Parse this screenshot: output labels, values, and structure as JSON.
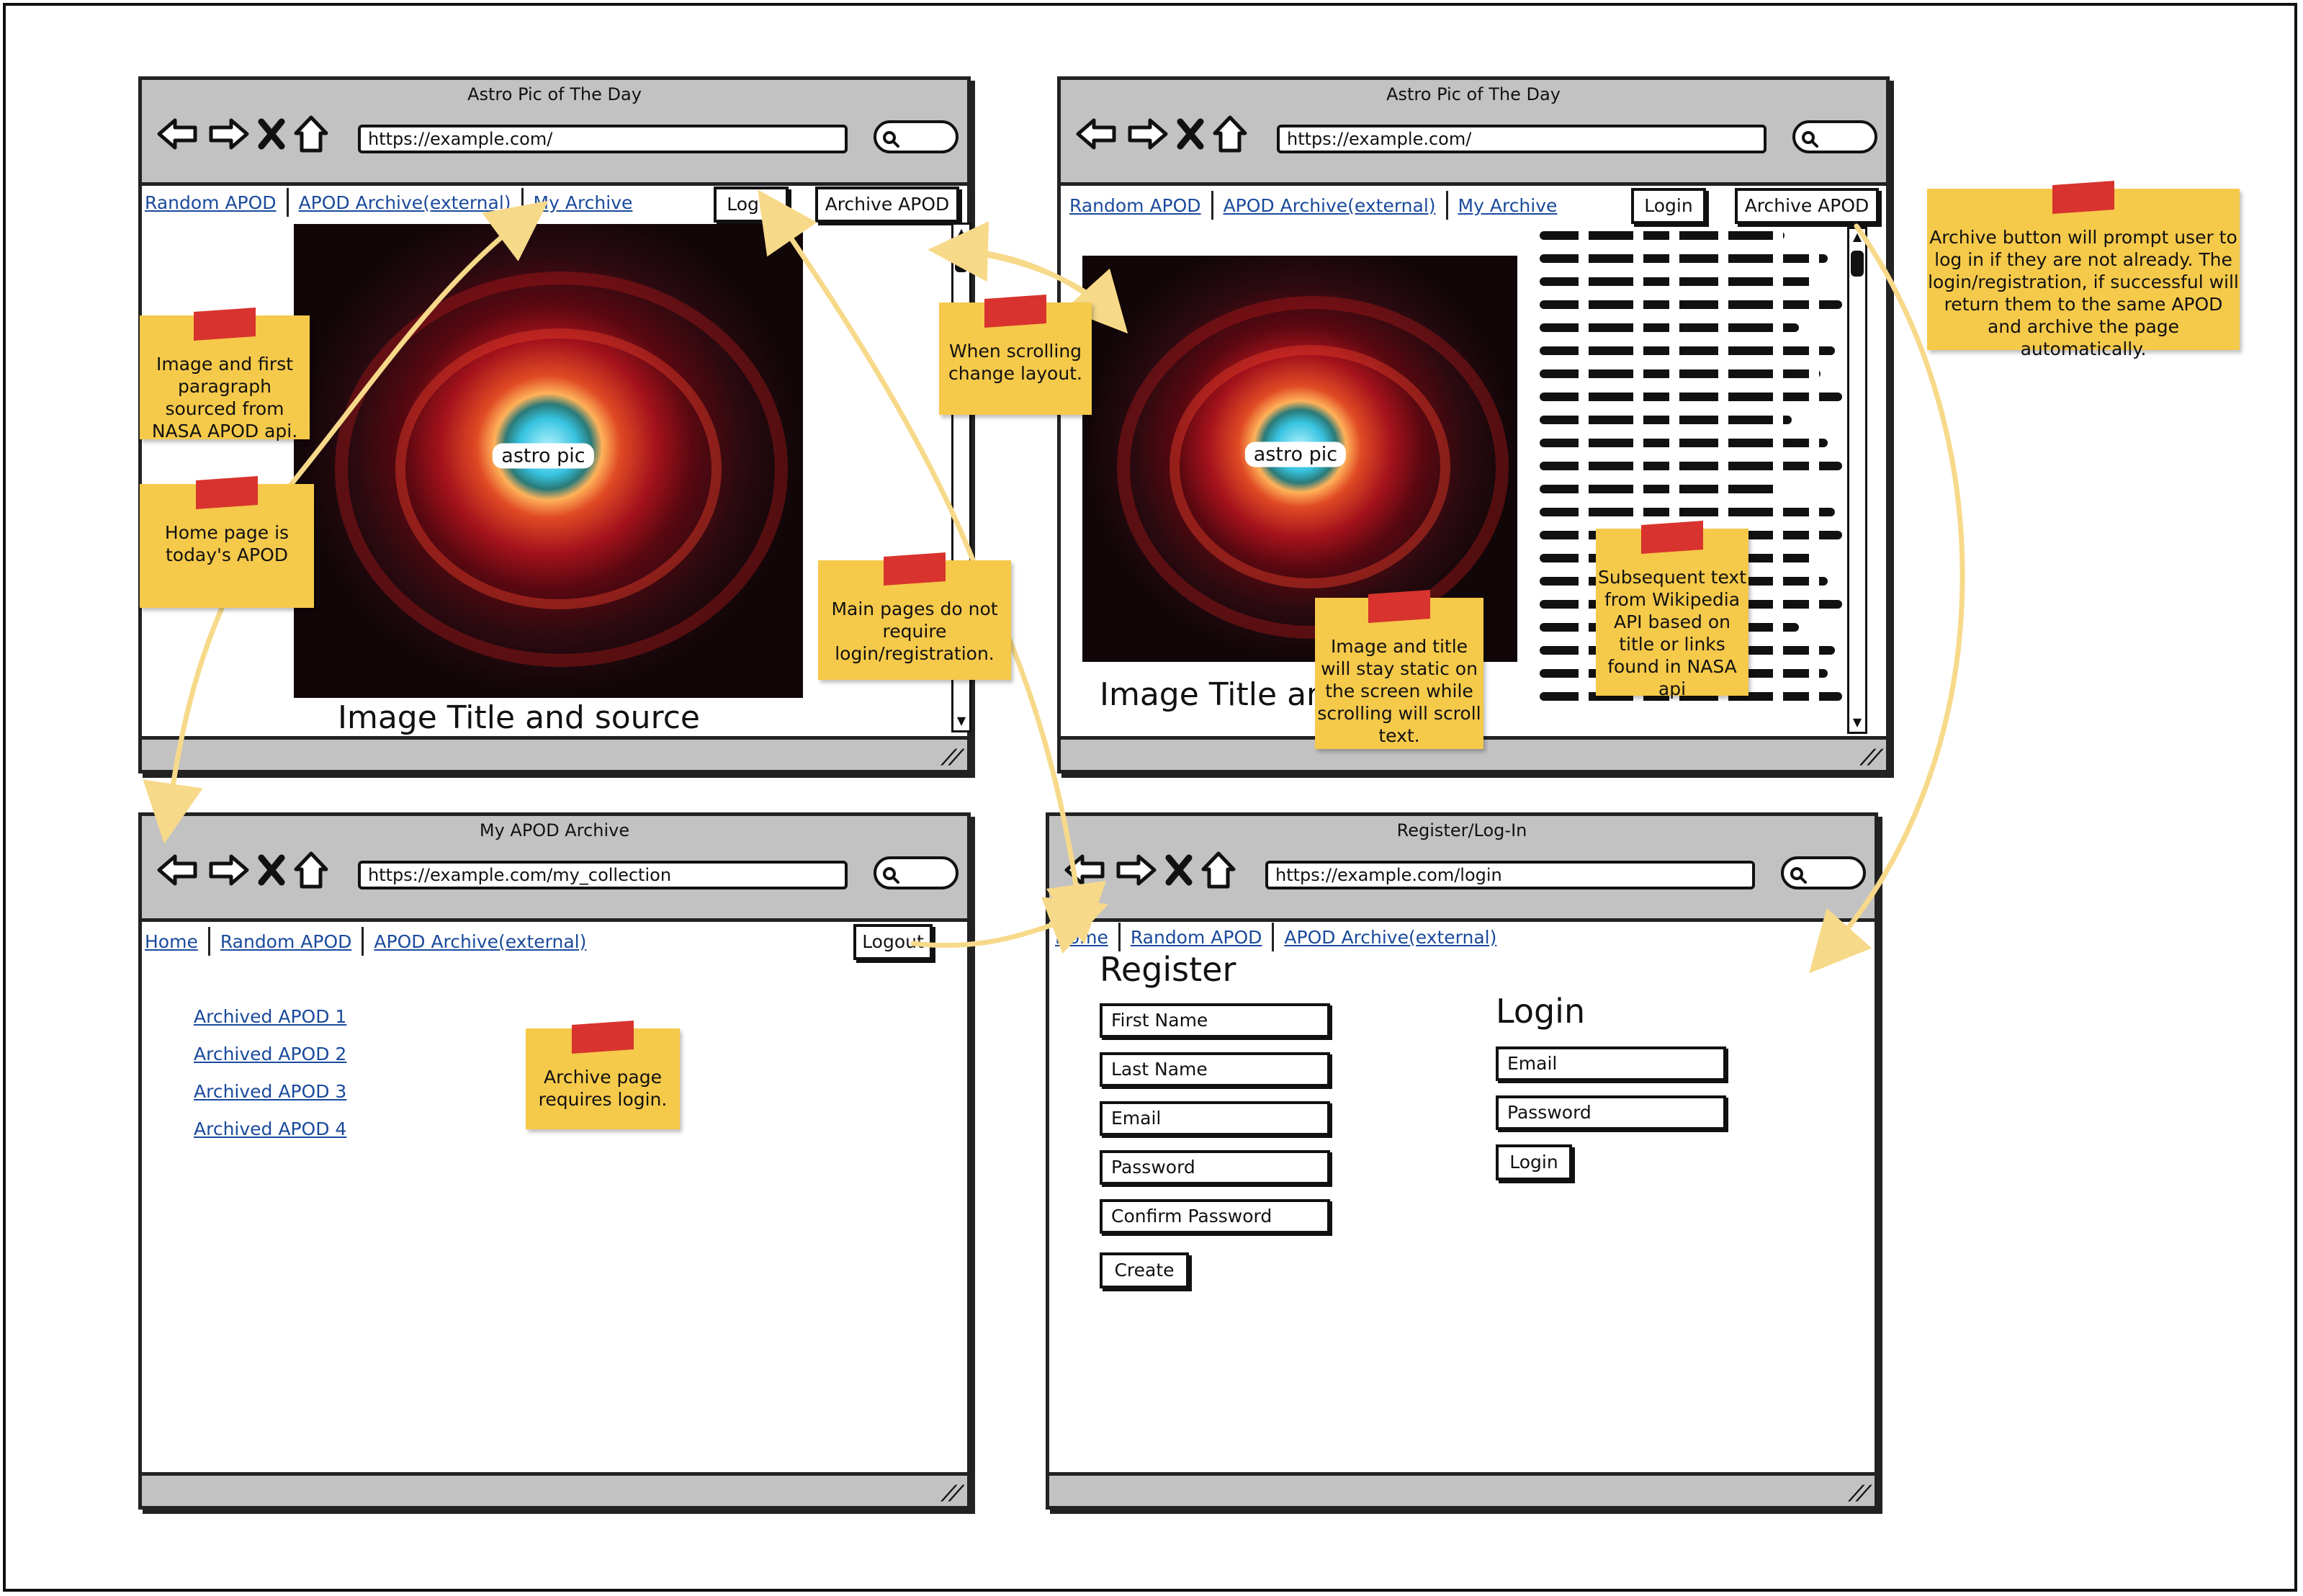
{
  "window_top_left": {
    "title": "Astro Pic of The Day",
    "url": "https://example.com/",
    "nav_links": [
      "Random APOD",
      "APOD Archive(external)",
      "My Archive"
    ],
    "login_button": "Login",
    "archive_button": "Archive APOD",
    "picture_label": "astro pic",
    "image_title": "Image Title and source"
  },
  "window_top_right": {
    "title": "Astro Pic of The Day",
    "url": "https://example.com/",
    "nav_links": [
      "Random APOD",
      "APOD Archive(external)",
      "My Archive"
    ],
    "login_button": "Login",
    "archive_button": "Archive APOD",
    "picture_label": "astro pic",
    "image_title": "Image Title an"
  },
  "window_bottom_left": {
    "title": "My APOD Archive",
    "url": "https://example.com/my_collection",
    "nav_links": [
      "Home",
      "Random APOD",
      "APOD Archive(external)"
    ],
    "logout_button": "Logout",
    "archived_items": [
      "Archived APOD 1",
      "Archived APOD 2",
      "Archived APOD 3",
      "Archived APOD 4"
    ]
  },
  "window_bottom_right": {
    "title": "Register/Log-In",
    "url": "https://example.com/login",
    "nav_links": [
      "Home",
      "Random APOD",
      "APOD Archive(external)"
    ],
    "register_heading": "Register",
    "register_fields": [
      "First Name",
      "Last Name",
      "Email",
      "Password",
      "Confirm Password"
    ],
    "create_button": "Create",
    "login_heading": "Login",
    "login_fields": [
      "Email",
      "Password"
    ],
    "login_button": "Login"
  },
  "notes": {
    "image_source": "Image and first paragraph sourced from NASA APOD api.",
    "home_page": "Home page is today's APOD",
    "scrolling": "When scrolling change layout.",
    "main_pages": "Main pages do not require login/registration.",
    "static_image": "Image and title will stay static on the screen while scrolling will scroll text.",
    "wikipedia": "Subsequent text from Wikipedia API based on title or links found in NASA api",
    "archive_button": "Archive button will prompt user to log in if they are not already. The login/registration, if successful will return them to the same APOD and archive the page automatically.",
    "archive_login": "Archive page requires login."
  },
  "colors": {
    "note": "#f5c94a",
    "tape": "#d8332e",
    "arrow": "#f7d98a",
    "link": "#1a4a9c",
    "chrome": "#c2c2c2"
  }
}
